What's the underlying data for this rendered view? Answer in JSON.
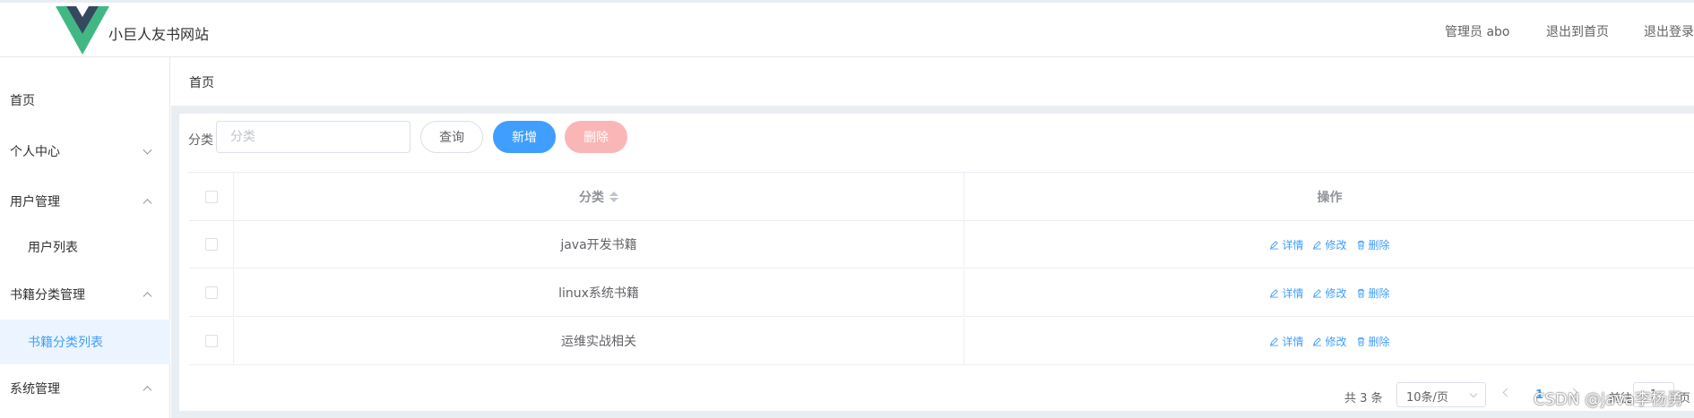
{
  "header": {
    "site_title": "小巨人友书网站",
    "admin_label": "管理员 abo",
    "back_home": "退出到首页",
    "logout": "退出登录"
  },
  "sidebar": {
    "items": [
      {
        "label": "首页"
      },
      {
        "label": "个人中心"
      },
      {
        "label": "用户管理"
      },
      {
        "label": "用户列表"
      },
      {
        "label": "书籍分类管理"
      },
      {
        "label": "书籍分类列表"
      },
      {
        "label": "系统管理"
      }
    ]
  },
  "breadcrumb": "首页",
  "search": {
    "label": "分类",
    "placeholder": "分类",
    "value": "",
    "query_button": "查询",
    "add_button": "新增",
    "delete_button": "删除"
  },
  "table": {
    "columns": {
      "category": "分类",
      "actions": "操作"
    },
    "rows": [
      {
        "category": "java开发书籍"
      },
      {
        "category": "linux系统书籍"
      },
      {
        "category": "运维实战相关"
      }
    ],
    "actions": {
      "detail": "详情",
      "edit": "修改",
      "delete": "删除"
    }
  },
  "pagination": {
    "total": "共 3 条",
    "page_size": "10条/页",
    "current_page": "1",
    "goto_label": "前往",
    "goto_value": "1",
    "page_suffix": "页"
  },
  "watermark": "CSDN @java李杨勇",
  "colors": {
    "primary": "#409eff",
    "danger_disabled": "#fab6b6",
    "logo_green": "#41b883",
    "logo_dark": "#35495e"
  }
}
